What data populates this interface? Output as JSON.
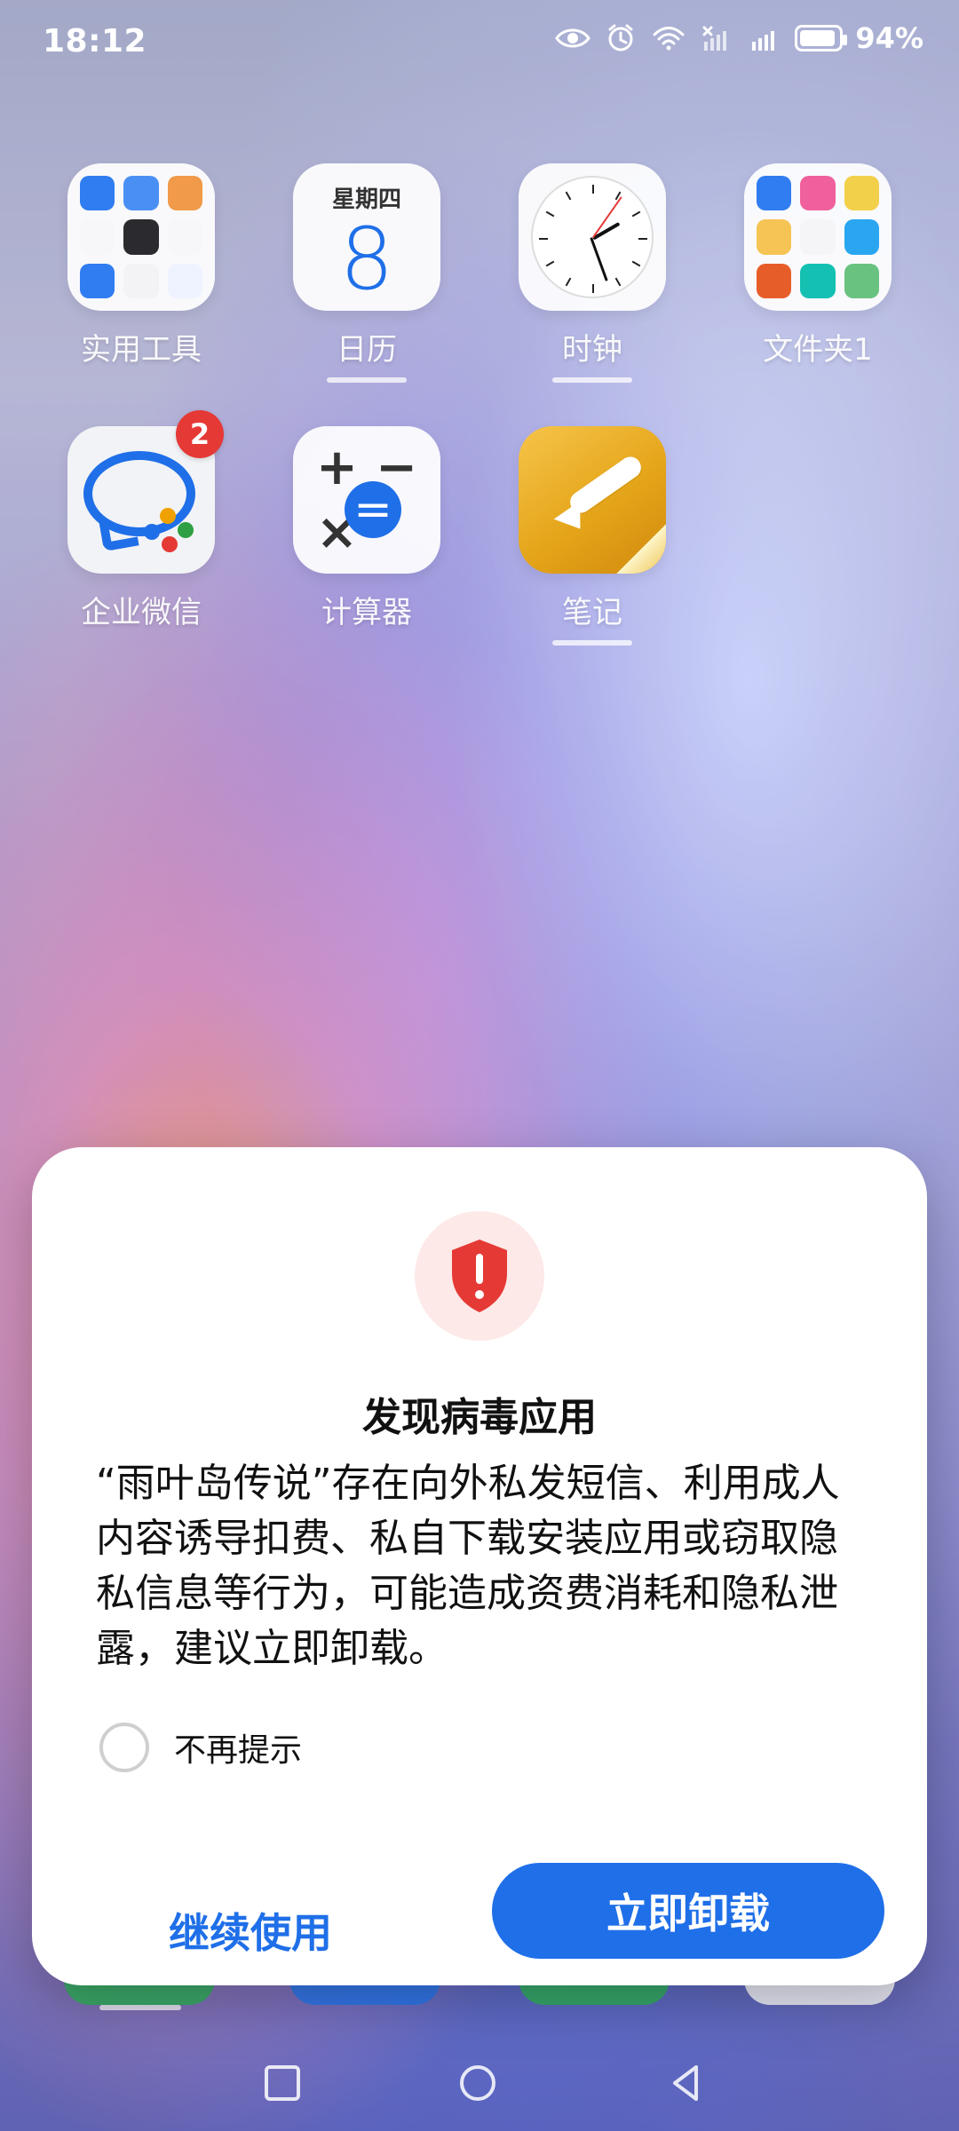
{
  "status_bar": {
    "time": "18:12",
    "battery_percent": "94%",
    "icons": [
      "eye-icon",
      "alarm-icon",
      "wifi-icon",
      "no-signal-icon",
      "4g-signal-icon",
      "battery-icon"
    ]
  },
  "home": {
    "apps_row1": [
      {
        "label": "实用工具",
        "icon": "folder-icon"
      },
      {
        "label": "日历",
        "icon": "calendar-icon",
        "weekday": "星期四",
        "day": "8"
      },
      {
        "label": "时钟",
        "icon": "clock-icon"
      },
      {
        "label": "文件夹1",
        "icon": "folder-icon"
      }
    ],
    "apps_row2": [
      {
        "label": "企业微信",
        "icon": "wecom-icon",
        "badge": "2"
      },
      {
        "label": "计算器",
        "icon": "calculator-icon"
      },
      {
        "label": "笔记",
        "icon": "notes-icon"
      }
    ]
  },
  "dialog": {
    "icon": "shield-alert-icon",
    "title": "发现病毒应用",
    "message": "“雨叶岛传说”存在向外私发短信、利用成人内容诱导扣费、私自下载安装应用或窃取隐私信息等行为，可能造成资费消耗和隐私泄露，建议立即卸载。",
    "checkbox_label": "不再提示",
    "checkbox_checked": false,
    "secondary_button": "继续使用",
    "primary_button": "立即卸载",
    "colors": {
      "primary": "#1f6fe8",
      "danger": "#e53935"
    }
  },
  "navigation": {
    "icons": [
      "recent-apps-icon",
      "home-icon",
      "back-icon"
    ]
  }
}
